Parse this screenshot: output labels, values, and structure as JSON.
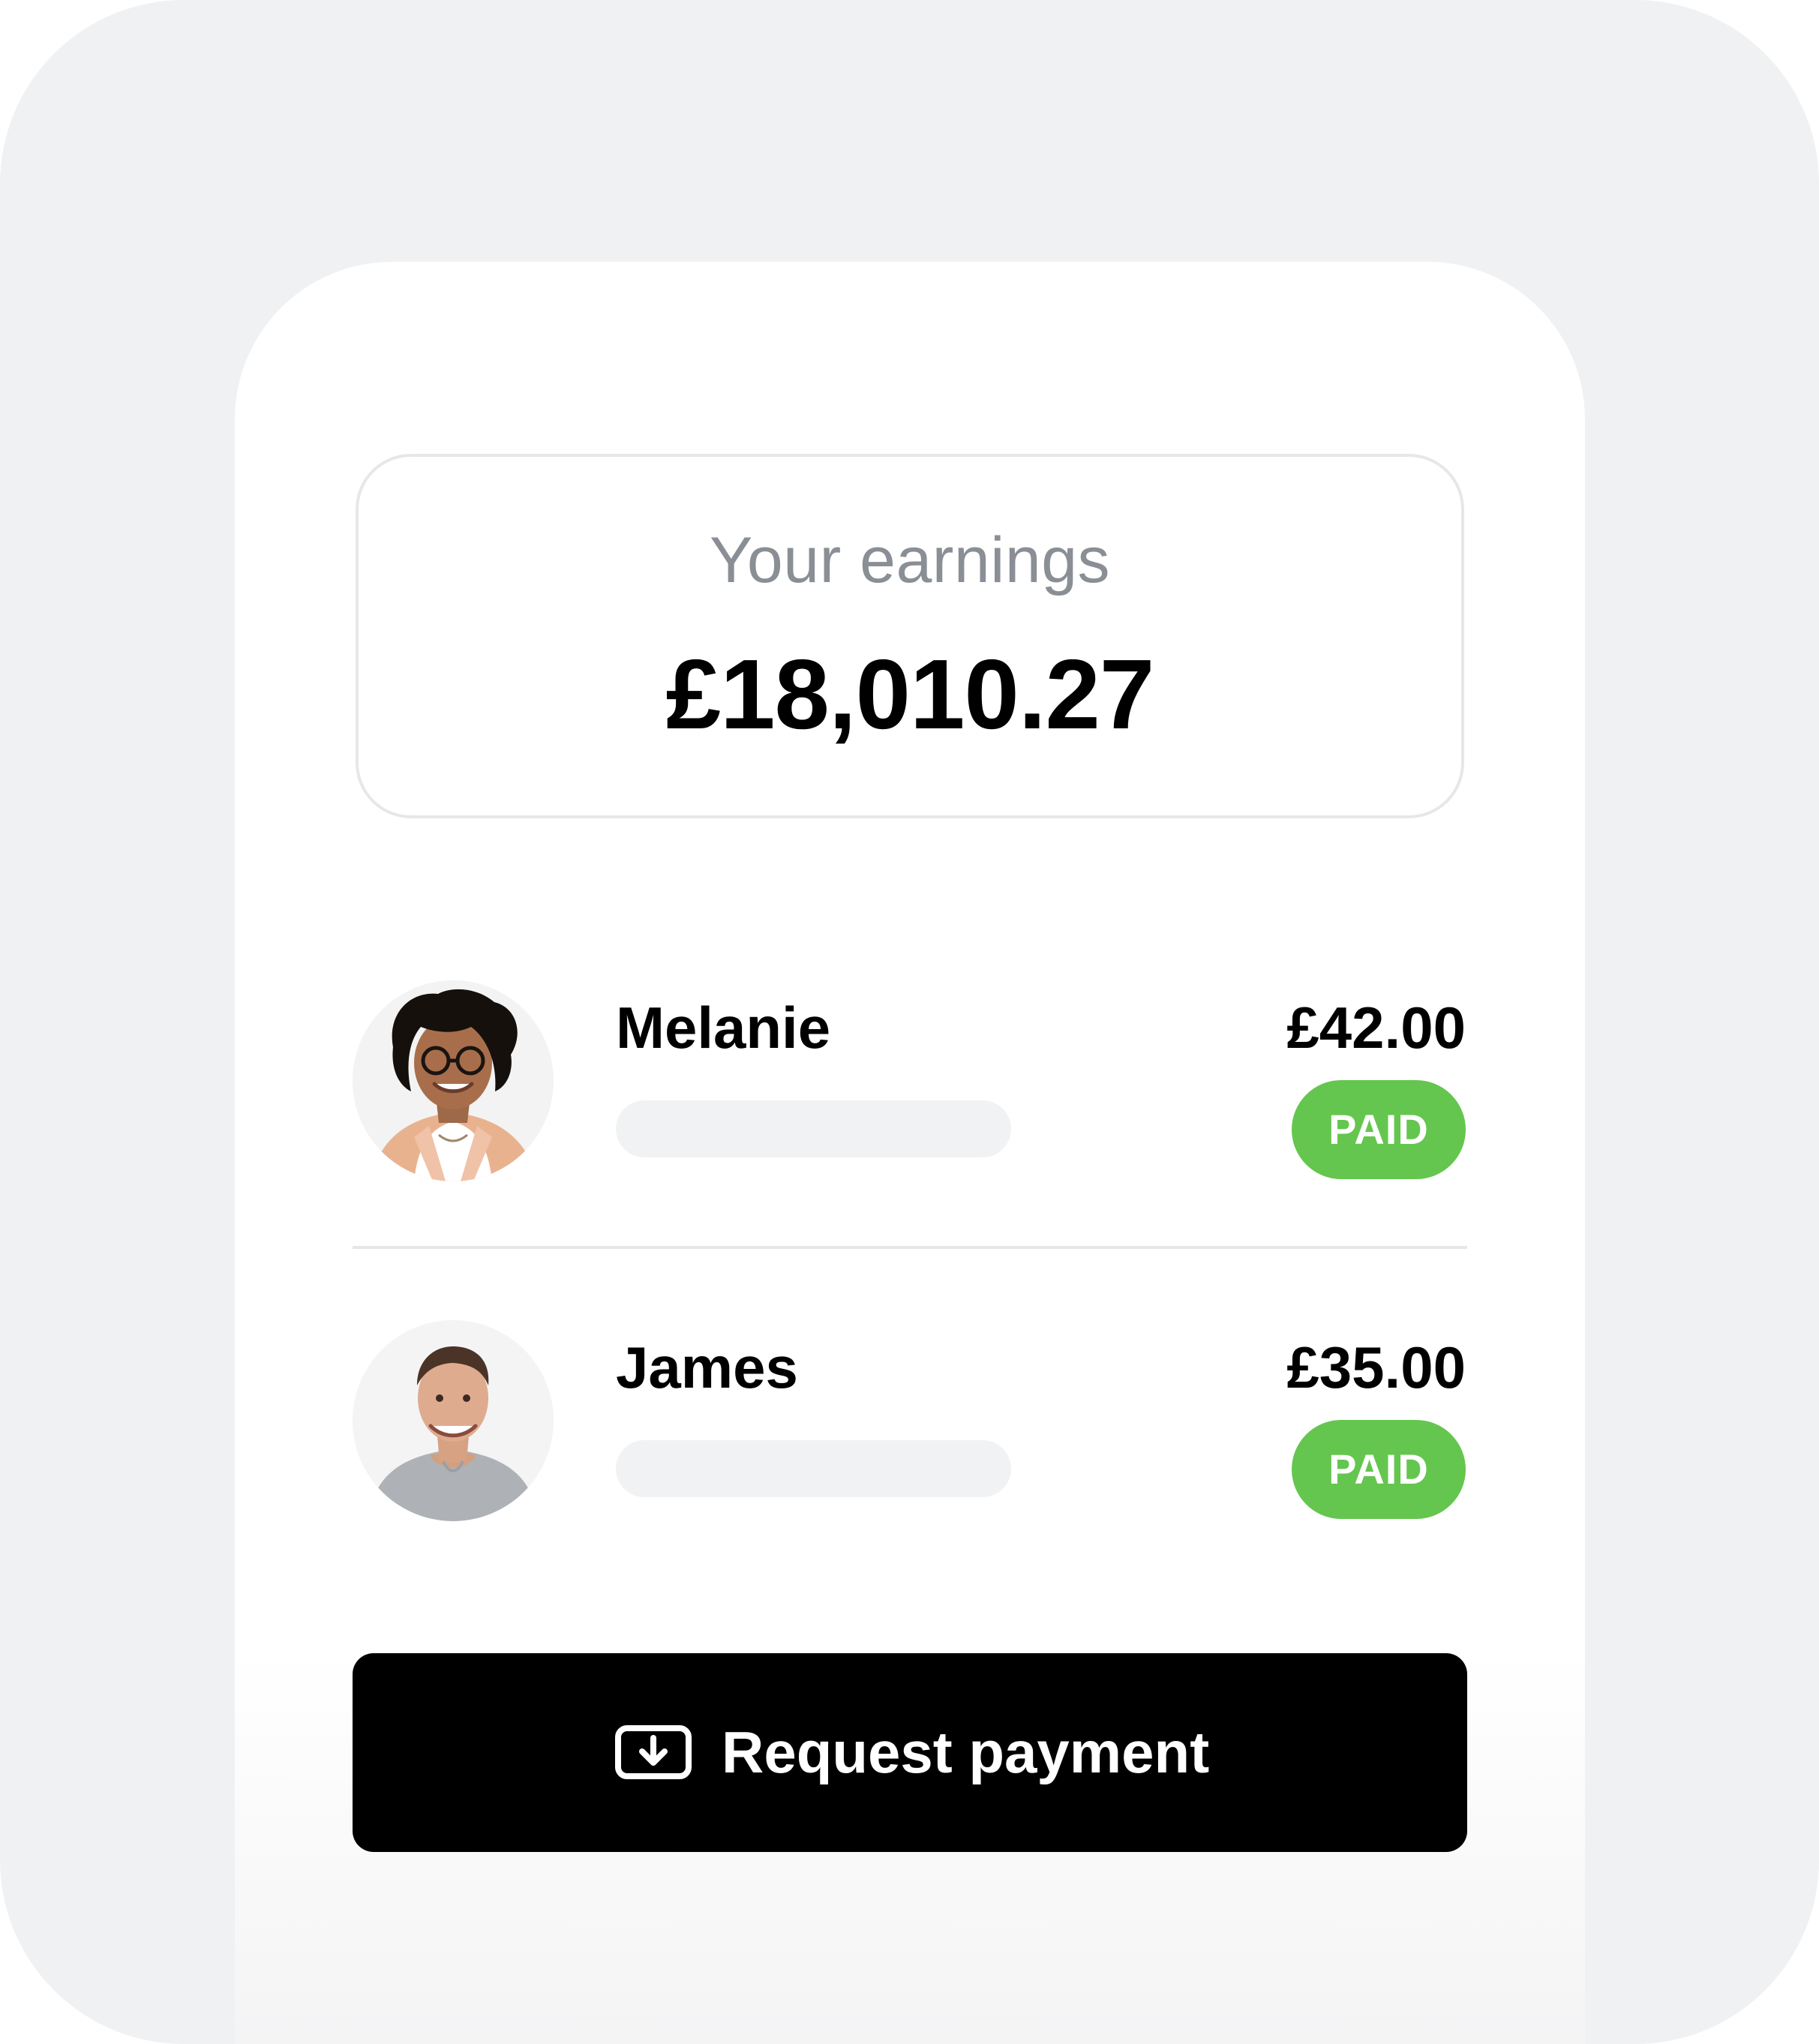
{
  "earnings": {
    "label": "Your earnings",
    "amount": "£18,010.27"
  },
  "payments": [
    {
      "name": "Melanie",
      "amount": "£42.00",
      "status": "PAID",
      "avatar": "melanie-photo"
    },
    {
      "name": "James",
      "amount": "£35.00",
      "status": "PAID",
      "avatar": "james-photo"
    }
  ],
  "action": {
    "label": "Request payment",
    "icon": "download-tray-icon"
  },
  "colors": {
    "background": "#f0f1f3",
    "surface": "#ffffff",
    "text": "#000000",
    "muted_text": "#8a8f96",
    "border": "#e6e7e9",
    "placeholder": "#f1f2f3",
    "success": "#64c64e",
    "button": "#000000",
    "button_text": "#ffffff"
  }
}
